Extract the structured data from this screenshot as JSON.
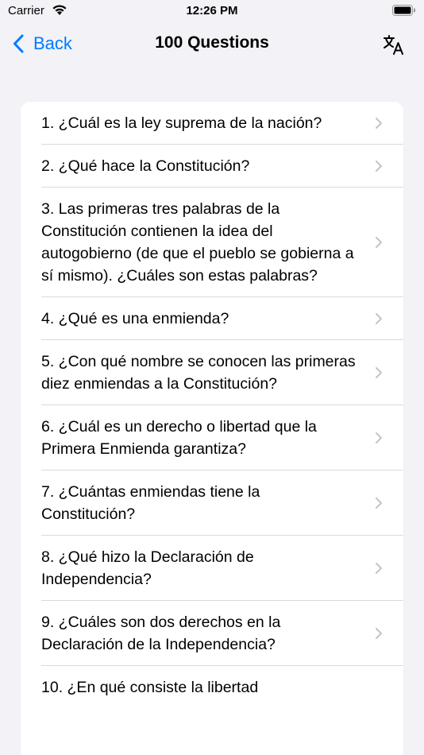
{
  "status": {
    "carrier": "Carrier",
    "time": "12:26 PM"
  },
  "nav": {
    "back_label": "Back",
    "title": "100 Questions"
  },
  "questions": [
    "1. ¿Cuál es la ley suprema de la nación?",
    "2. ¿Qué hace la Constitución?",
    "3. Las primeras tres palabras de la Constitución contienen la idea del autogobierno (de que el pueblo se gobierna a sí mismo). ¿Cuáles son estas palabras?",
    "4. ¿Qué es una enmienda?",
    "5. ¿Con qué nombre se conocen las primeras diez enmiendas a la Constitución?",
    "6. ¿Cuál es un derecho o libertad que la Primera Enmienda garantiza?",
    "7. ¿Cuántas enmiendas tiene la Constitución?",
    "8. ¿Qué hizo la Declaración de Independencia?",
    "9. ¿Cuáles son dos derechos en la Declaración de la Independencia?",
    "10. ¿En qué consiste la libertad"
  ],
  "icons": {
    "back": "chevron-left-icon",
    "translate": "translate-icon",
    "row": "chevron-right-icon"
  },
  "colors": {
    "accent": "#007aff",
    "background": "#f2f2f7",
    "chevron": "#c4c4c7"
  }
}
